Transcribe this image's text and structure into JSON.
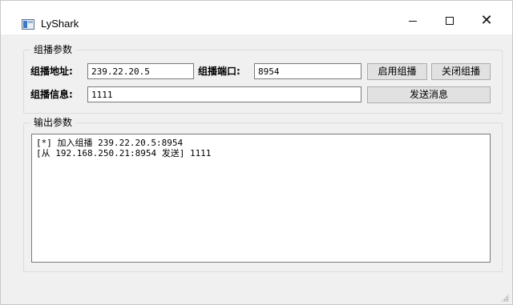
{
  "window": {
    "title": "LyShark",
    "minimize_icon": "minimize-icon",
    "maximize_icon": "maximize-icon",
    "close_icon": "close-icon"
  },
  "multicast_params": {
    "group_title": "组播参数",
    "address_label": "组播地址:",
    "address_value": "239.22.20.5",
    "port_label": "组播端口:",
    "port_value": "8954",
    "message_label": "组播信息:",
    "message_value": "1111",
    "enable_button": "启用组播",
    "close_button": "关闭组播",
    "send_button": "发送消息"
  },
  "output_params": {
    "group_title": "输出参数",
    "lines": [
      "[*] 加入组播 239.22.20.5:8954",
      "[从 192.168.250.21:8954 发送] 1111"
    ]
  }
}
